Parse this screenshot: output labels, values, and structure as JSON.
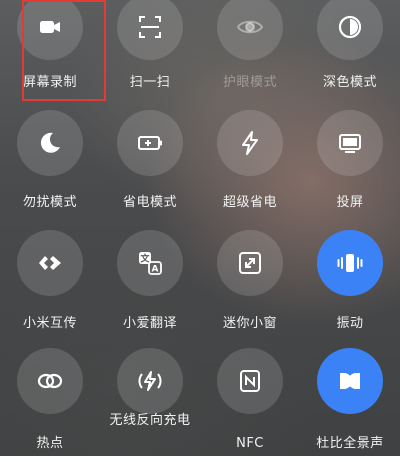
{
  "tiles": [
    {
      "label": "屏幕录制",
      "icon": "video-camera-icon"
    },
    {
      "label": "扫一扫",
      "icon": "scan-icon"
    },
    {
      "label": "护眼模式",
      "icon": "eye-icon"
    },
    {
      "label": "深色模式",
      "icon": "dark-mode-icon"
    },
    {
      "label": "勿扰模式",
      "icon": "moon-icon"
    },
    {
      "label": "省电模式",
      "icon": "battery-icon"
    },
    {
      "label": "超级省电",
      "icon": "lightning-icon"
    },
    {
      "label": "投屏",
      "icon": "monitor-icon"
    },
    {
      "label": "小米互传",
      "icon": "share-transfer-icon"
    },
    {
      "label": "小爱翻译",
      "icon": "translate-icon"
    },
    {
      "label": "迷你小窗",
      "icon": "mini-window-icon"
    },
    {
      "label": "振动",
      "icon": "vibrate-icon"
    },
    {
      "label": "热点",
      "icon": "hotspot-icon"
    },
    {
      "label": "无线反向充电",
      "icon": "reverse-charge-icon"
    },
    {
      "label": "NFC",
      "icon": "nfc-icon"
    },
    {
      "label": "杜比全景声",
      "icon": "dolby-icon"
    }
  ],
  "colors": {
    "active": "#3b82f6",
    "highlight": "#e23b35"
  }
}
